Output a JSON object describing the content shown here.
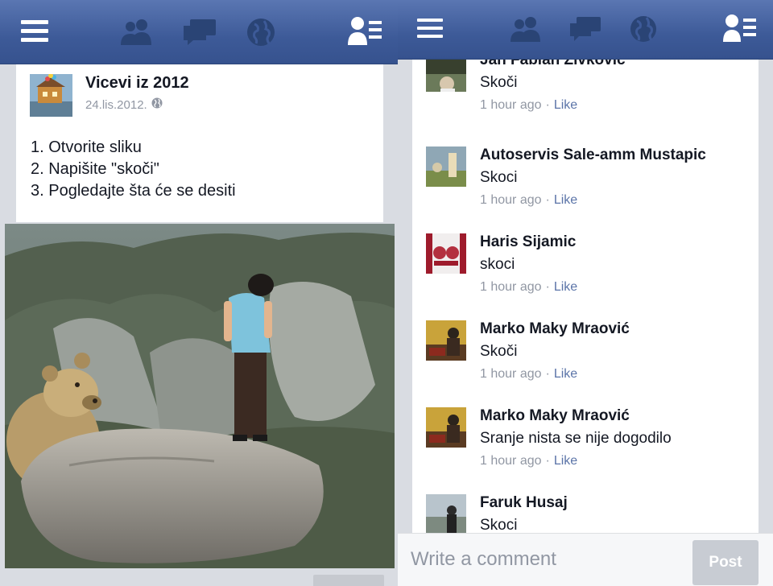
{
  "left": {
    "navbar": {
      "icons": [
        "menu-icon",
        "friend-requests-icon",
        "messages-icon",
        "notifications-globe-icon",
        "contacts-icon"
      ]
    },
    "post": {
      "author": "Vicevi iz 2012",
      "date": "24.lis.2012.",
      "privacy_icon": "globe-icon",
      "lines": [
        "1. Otvorite sliku",
        "2. Napišite \"skoči\"",
        "3. Pogledajte šta će se desiti"
      ],
      "image": "photo-man-on-cliff-bear"
    }
  },
  "right": {
    "navbar": {
      "icons": [
        "menu-icon",
        "friend-requests-icon",
        "messages-icon",
        "notifications-globe-icon",
        "contacts-icon"
      ]
    },
    "comments": [
      {
        "name": "Jan Fabian Zivković",
        "text": "Skoči",
        "time": "1 hour ago",
        "like": "Like"
      },
      {
        "name": "Autoservis Sale-amm Mustapic",
        "text": "Skoci",
        "time": "1 hour ago",
        "like": "Like"
      },
      {
        "name": "Haris Sijamic",
        "text": "skoci",
        "time": "1 hour ago",
        "like": "Like"
      },
      {
        "name": "Marko Maky Mraović",
        "text": "Skoči",
        "time": "1 hour ago",
        "like": "Like"
      },
      {
        "name": "Marko Maky Mraović",
        "text": "Sranje nista se nije dogodilo",
        "time": "1 hour ago",
        "like": "Like"
      },
      {
        "name": "Faruk Husaj",
        "text": "Skoci",
        "time": "",
        "like": ""
      }
    ],
    "composer": {
      "placeholder": "Write a comment",
      "post_label": "Post"
    }
  }
}
